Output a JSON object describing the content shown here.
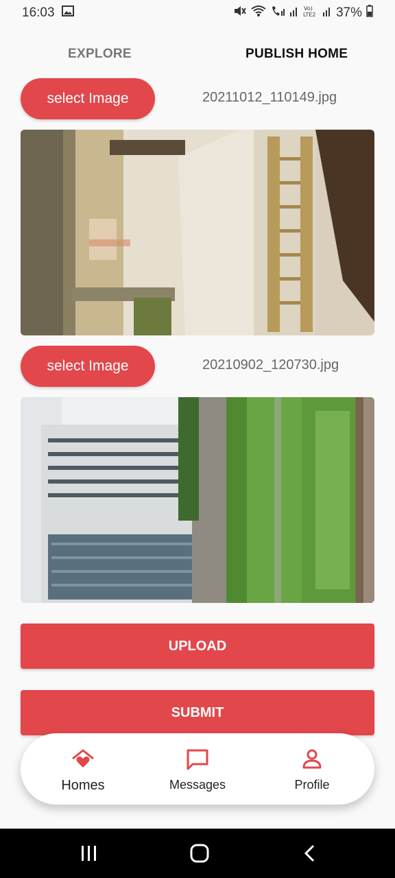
{
  "status_bar": {
    "time": "16:03",
    "battery": "37%",
    "icons": [
      "gallery-icon",
      "mute-icon",
      "wifi-icon",
      "wifi-call-icon",
      "signal-icon",
      "volte-icon",
      "signal-icon",
      "battery-icon"
    ]
  },
  "tabs": [
    {
      "label": "EXPLORE",
      "active": false
    },
    {
      "label": "PUBLISH HOME",
      "active": true
    }
  ],
  "image_slots": [
    {
      "button_label": "select Image",
      "file_name": "20211012_110149.jpg"
    },
    {
      "button_label": "select Image",
      "file_name": "20210902_120730.jpg"
    }
  ],
  "actions": {
    "upload_label": "UPLOAD",
    "submit_label": "SUBMIT"
  },
  "bottom_nav": [
    {
      "label": "Homes",
      "icon": "home-heart-icon",
      "active": true
    },
    {
      "label": "Messages",
      "icon": "chat-bubble-icon",
      "active": false
    },
    {
      "label": "Profile",
      "icon": "person-icon",
      "active": false
    }
  ],
  "colors": {
    "accent": "#e2474b",
    "background": "#f9f9f9"
  },
  "system_nav": [
    "recent-apps-icon",
    "home-icon",
    "back-icon"
  ]
}
